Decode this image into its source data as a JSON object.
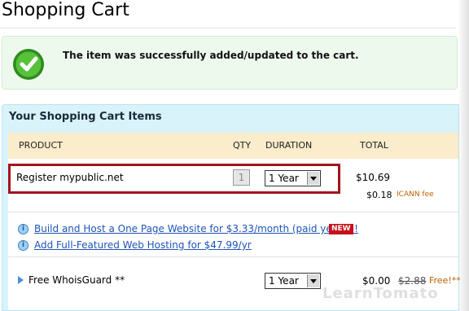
{
  "page": {
    "title": "Shopping Cart"
  },
  "notice": {
    "icon": "checkmark-icon",
    "message": "The item was successfully added/updated to the cart."
  },
  "cart": {
    "heading": "Your Shopping Cart Items",
    "columns": {
      "product": "PRODUCT",
      "qty": "QTY",
      "duration": "DURATION",
      "total": "TOTAL"
    },
    "item": {
      "name": "Register mypublic.net",
      "qty": "1",
      "duration": "1 Year",
      "total": "$10.69",
      "fee_amount": "$0.18",
      "fee_label": "ICANN fee"
    },
    "promos": [
      {
        "text": "Build and Host a One Page Website for $3.33/month (paid yearly)!",
        "icon": "info-icon",
        "badge": "NEW"
      },
      {
        "text": "Add Full-Featured Web Hosting for $47.99/yr",
        "icon": "info-icon"
      }
    ],
    "addon": {
      "name": "Free WhoisGuard **",
      "duration": "1 Year",
      "price": "$0.00",
      "old_price": "$2.88",
      "free_label": "Free!**"
    }
  },
  "watermark": "LearnTomato",
  "colors": {
    "highlight_border": "#a3141e",
    "header_row": "#fbeccb",
    "panel": "#d9f3fb",
    "link": "#1f55b5",
    "badge": "#c8101a"
  }
}
